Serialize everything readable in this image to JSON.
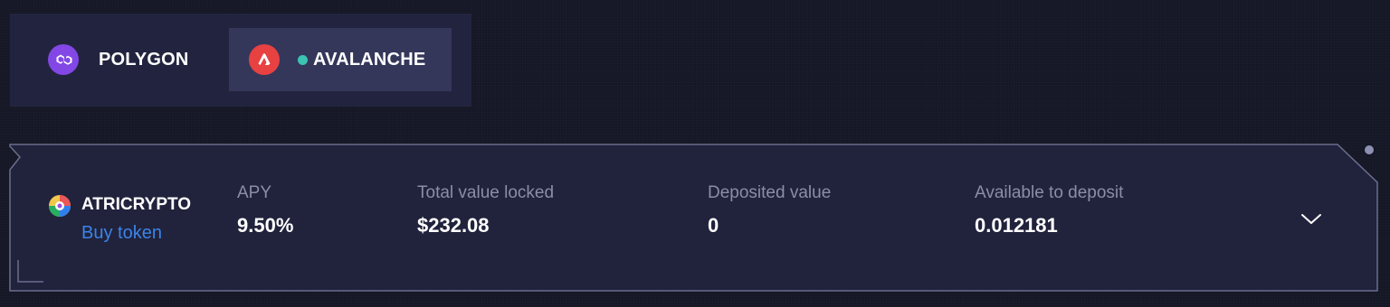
{
  "networks": {
    "tabs": [
      {
        "label": "POLYGON",
        "icon": "polygon-logo-icon",
        "color": "#8247e5",
        "active": false
      },
      {
        "label": "AVALANCHE",
        "icon": "avalanche-logo-icon",
        "color": "#e84142",
        "active": true
      }
    ],
    "active_indicator_color": "#3cc3b3"
  },
  "pool": {
    "token_name": "ATRICRYPTO",
    "token_icon": "atricrypto-token-icon",
    "buy_link": "Buy token",
    "stats": {
      "apy_label": "APY",
      "apy_value": "9.50%",
      "tvl_label": "Total value locked",
      "tvl_value": "$232.08",
      "deposited_label": "Deposited value",
      "deposited_value": "0",
      "available_label": "Available to deposit",
      "available_value": "0.012181"
    },
    "expand_icon": "chevron-down-icon"
  },
  "colors": {
    "background": "#151726",
    "panel": "#22243f",
    "active_tab": "#34375a",
    "link": "#3b84e8",
    "muted_text": "#8b8ea8"
  }
}
